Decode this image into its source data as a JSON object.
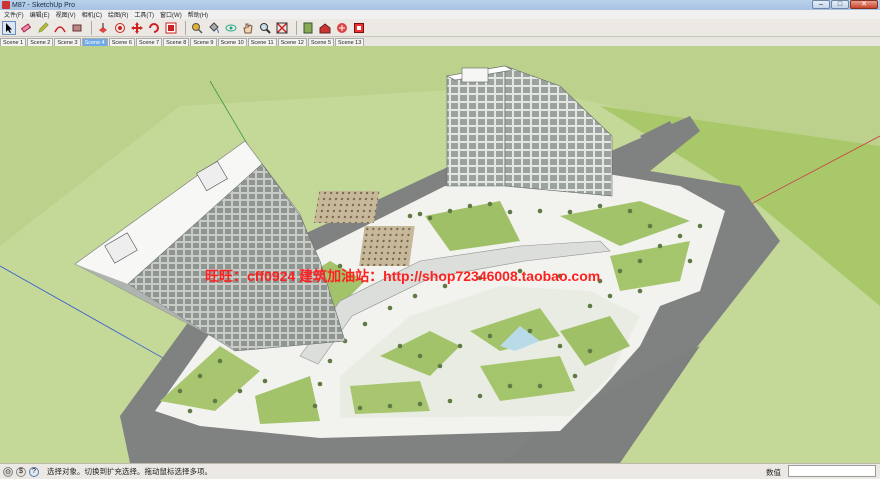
{
  "window": {
    "title": "M87 - SketchUp Pro",
    "min": "–",
    "max": "□",
    "close": "✕"
  },
  "menu": [
    "文件(F)",
    "编辑(E)",
    "视图(V)",
    "相机(C)",
    "绘图(R)",
    "工具(T)",
    "窗口(W)",
    "帮助(H)"
  ],
  "toolbar": {
    "tools": [
      {
        "name": "select-tool",
        "icon": "arrow"
      },
      {
        "name": "eraser-tool",
        "icon": "eraser"
      },
      {
        "name": "pencil-tool",
        "icon": "pencil"
      },
      {
        "name": "arc-tool",
        "icon": "arc"
      },
      {
        "name": "rectangle-tool",
        "icon": "rect"
      },
      {
        "name": "push-pull-tool",
        "icon": "pushpull"
      },
      {
        "name": "offset-tool",
        "icon": "offset"
      },
      {
        "name": "move-tool",
        "icon": "move"
      },
      {
        "name": "rotate-tool",
        "icon": "rotate"
      },
      {
        "name": "scale-tool",
        "icon": "scale"
      },
      {
        "name": "tape-measure-tool",
        "icon": "tape"
      },
      {
        "name": "paint-bucket-tool",
        "icon": "paint"
      },
      {
        "name": "orbit-tool",
        "icon": "orbit"
      },
      {
        "name": "pan-tool",
        "icon": "pan"
      },
      {
        "name": "zoom-tool",
        "icon": "zoom"
      },
      {
        "name": "zoom-extents-tool",
        "icon": "extents"
      },
      {
        "name": "components-tool",
        "icon": "components"
      },
      {
        "name": "warehouse-tool",
        "icon": "warehouse"
      },
      {
        "name": "share-model-tool",
        "icon": "share"
      },
      {
        "name": "extension-tool",
        "icon": "ext"
      }
    ]
  },
  "scenes": [
    "Scene 1",
    "Scene 2",
    "Scene 3",
    "Scene 4",
    "Scene 6",
    "Scene 7",
    "Scene 8",
    "Scene 9",
    "Scene 10",
    "Scene 11",
    "Scene 12",
    "Scene 5",
    "Scene 13"
  ],
  "active_scene_index": 3,
  "watermarks": {
    "left": "旺旺：cff0924  建筑加油站：http://shop72346008.taobao.com"
  },
  "status": {
    "message": "选择对象。切换到扩充选择。拖动鼠标选择多项。",
    "measure_label": "数值",
    "measure_value": ""
  }
}
